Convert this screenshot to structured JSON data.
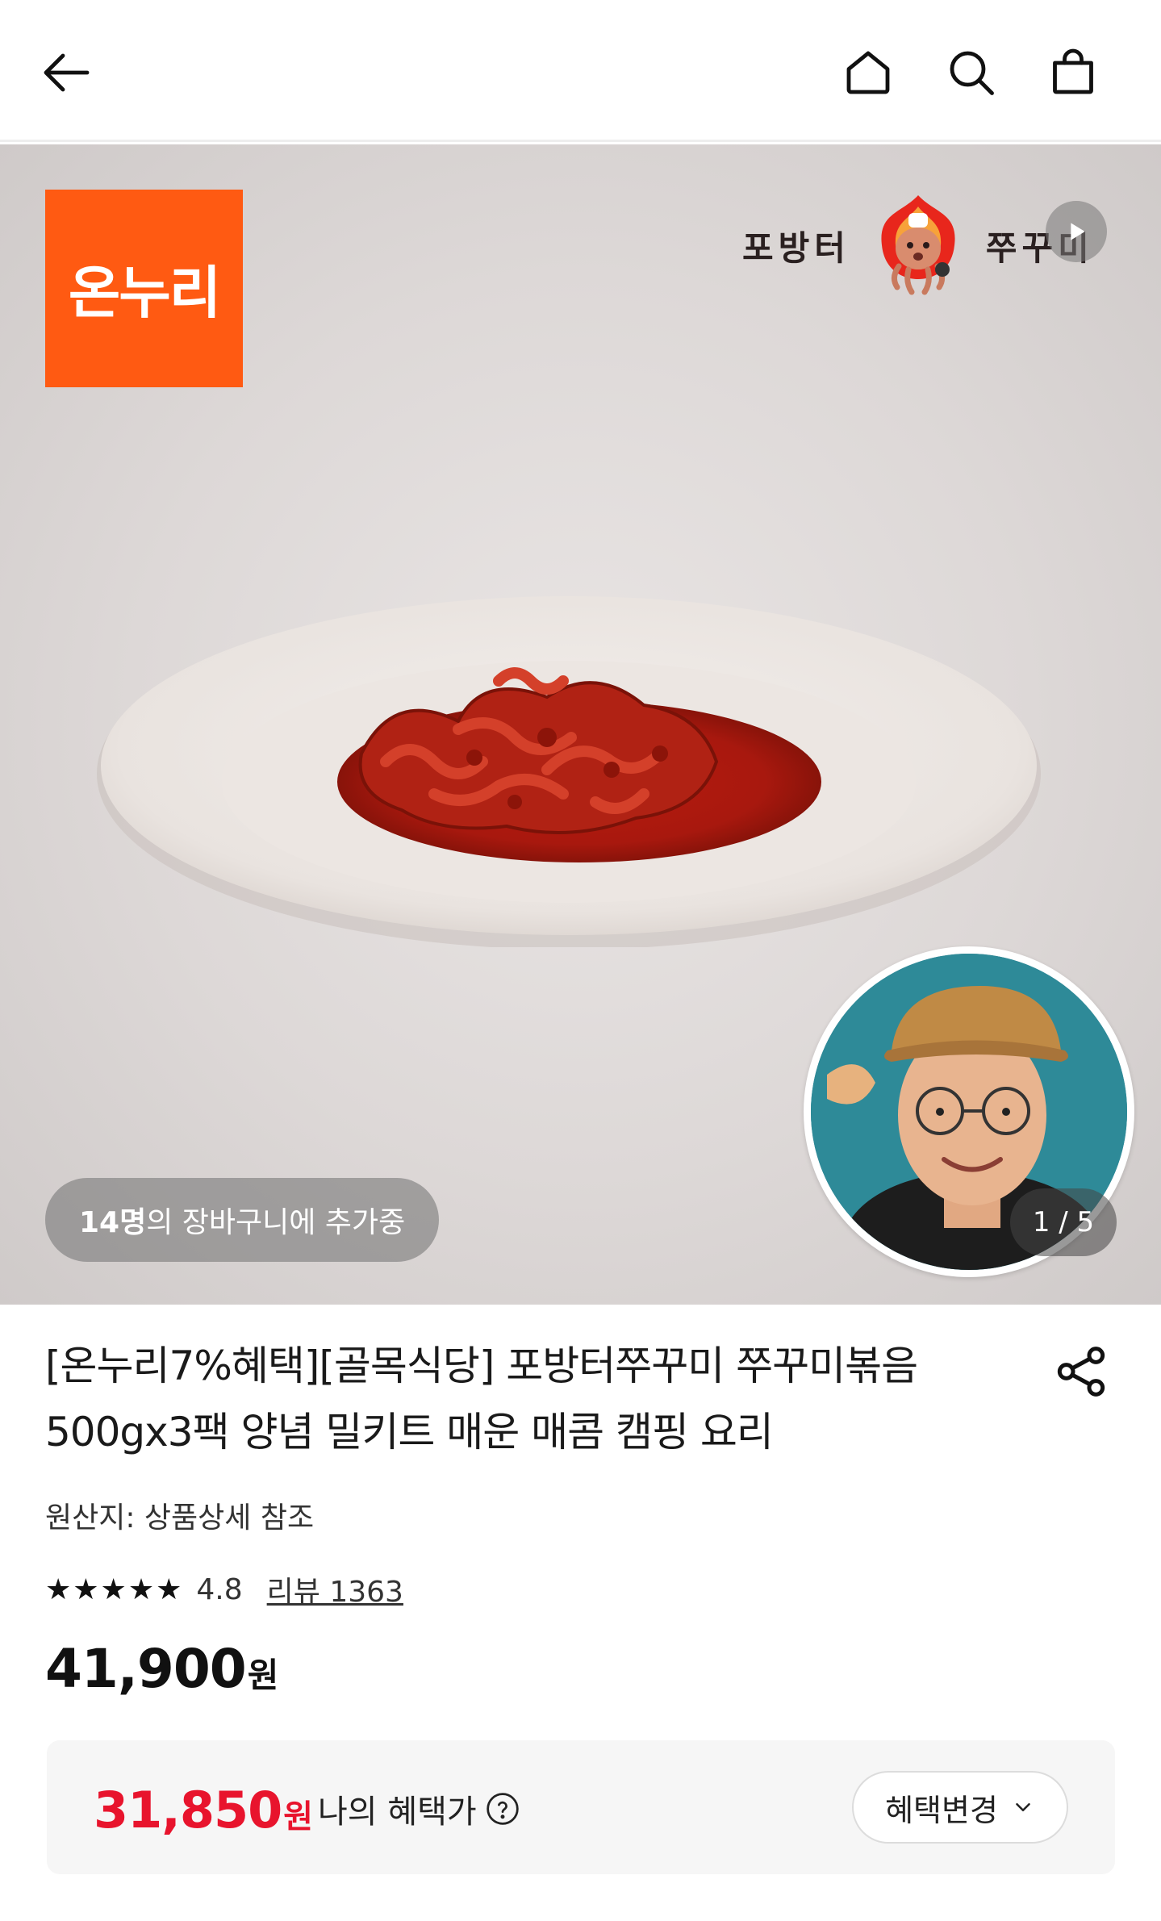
{
  "header": {
    "icons": [
      "back-arrow-icon",
      "home-icon",
      "search-icon",
      "shopping-bag-icon"
    ]
  },
  "hero": {
    "brand_logo_text": "온누리",
    "shop_sign_left": "포방터",
    "shop_sign_right": "쭈꾸미",
    "cart_count": "14명",
    "cart_suffix": "의 장바구니에 추가중",
    "image_counter": "1 / 5",
    "brand_color": "#ff5a12"
  },
  "product": {
    "title": "[온누리7%혜택][골목식당] 포방터쭈꾸미 쭈꾸미볶음 500gx3팩 양념 밀키트 매운 매콤 캠핑 요리",
    "origin": "원산지: 상품상세 참조",
    "stars": "★★★★★",
    "rating": "4.8",
    "reviews": "리뷰 1363",
    "price": "41,900",
    "price_unit": "원"
  },
  "benefit": {
    "price": "31,850",
    "price_unit": "원",
    "label": "나의 혜택가",
    "change_button": "혜택변경",
    "accent_color": "#e8142d"
  }
}
